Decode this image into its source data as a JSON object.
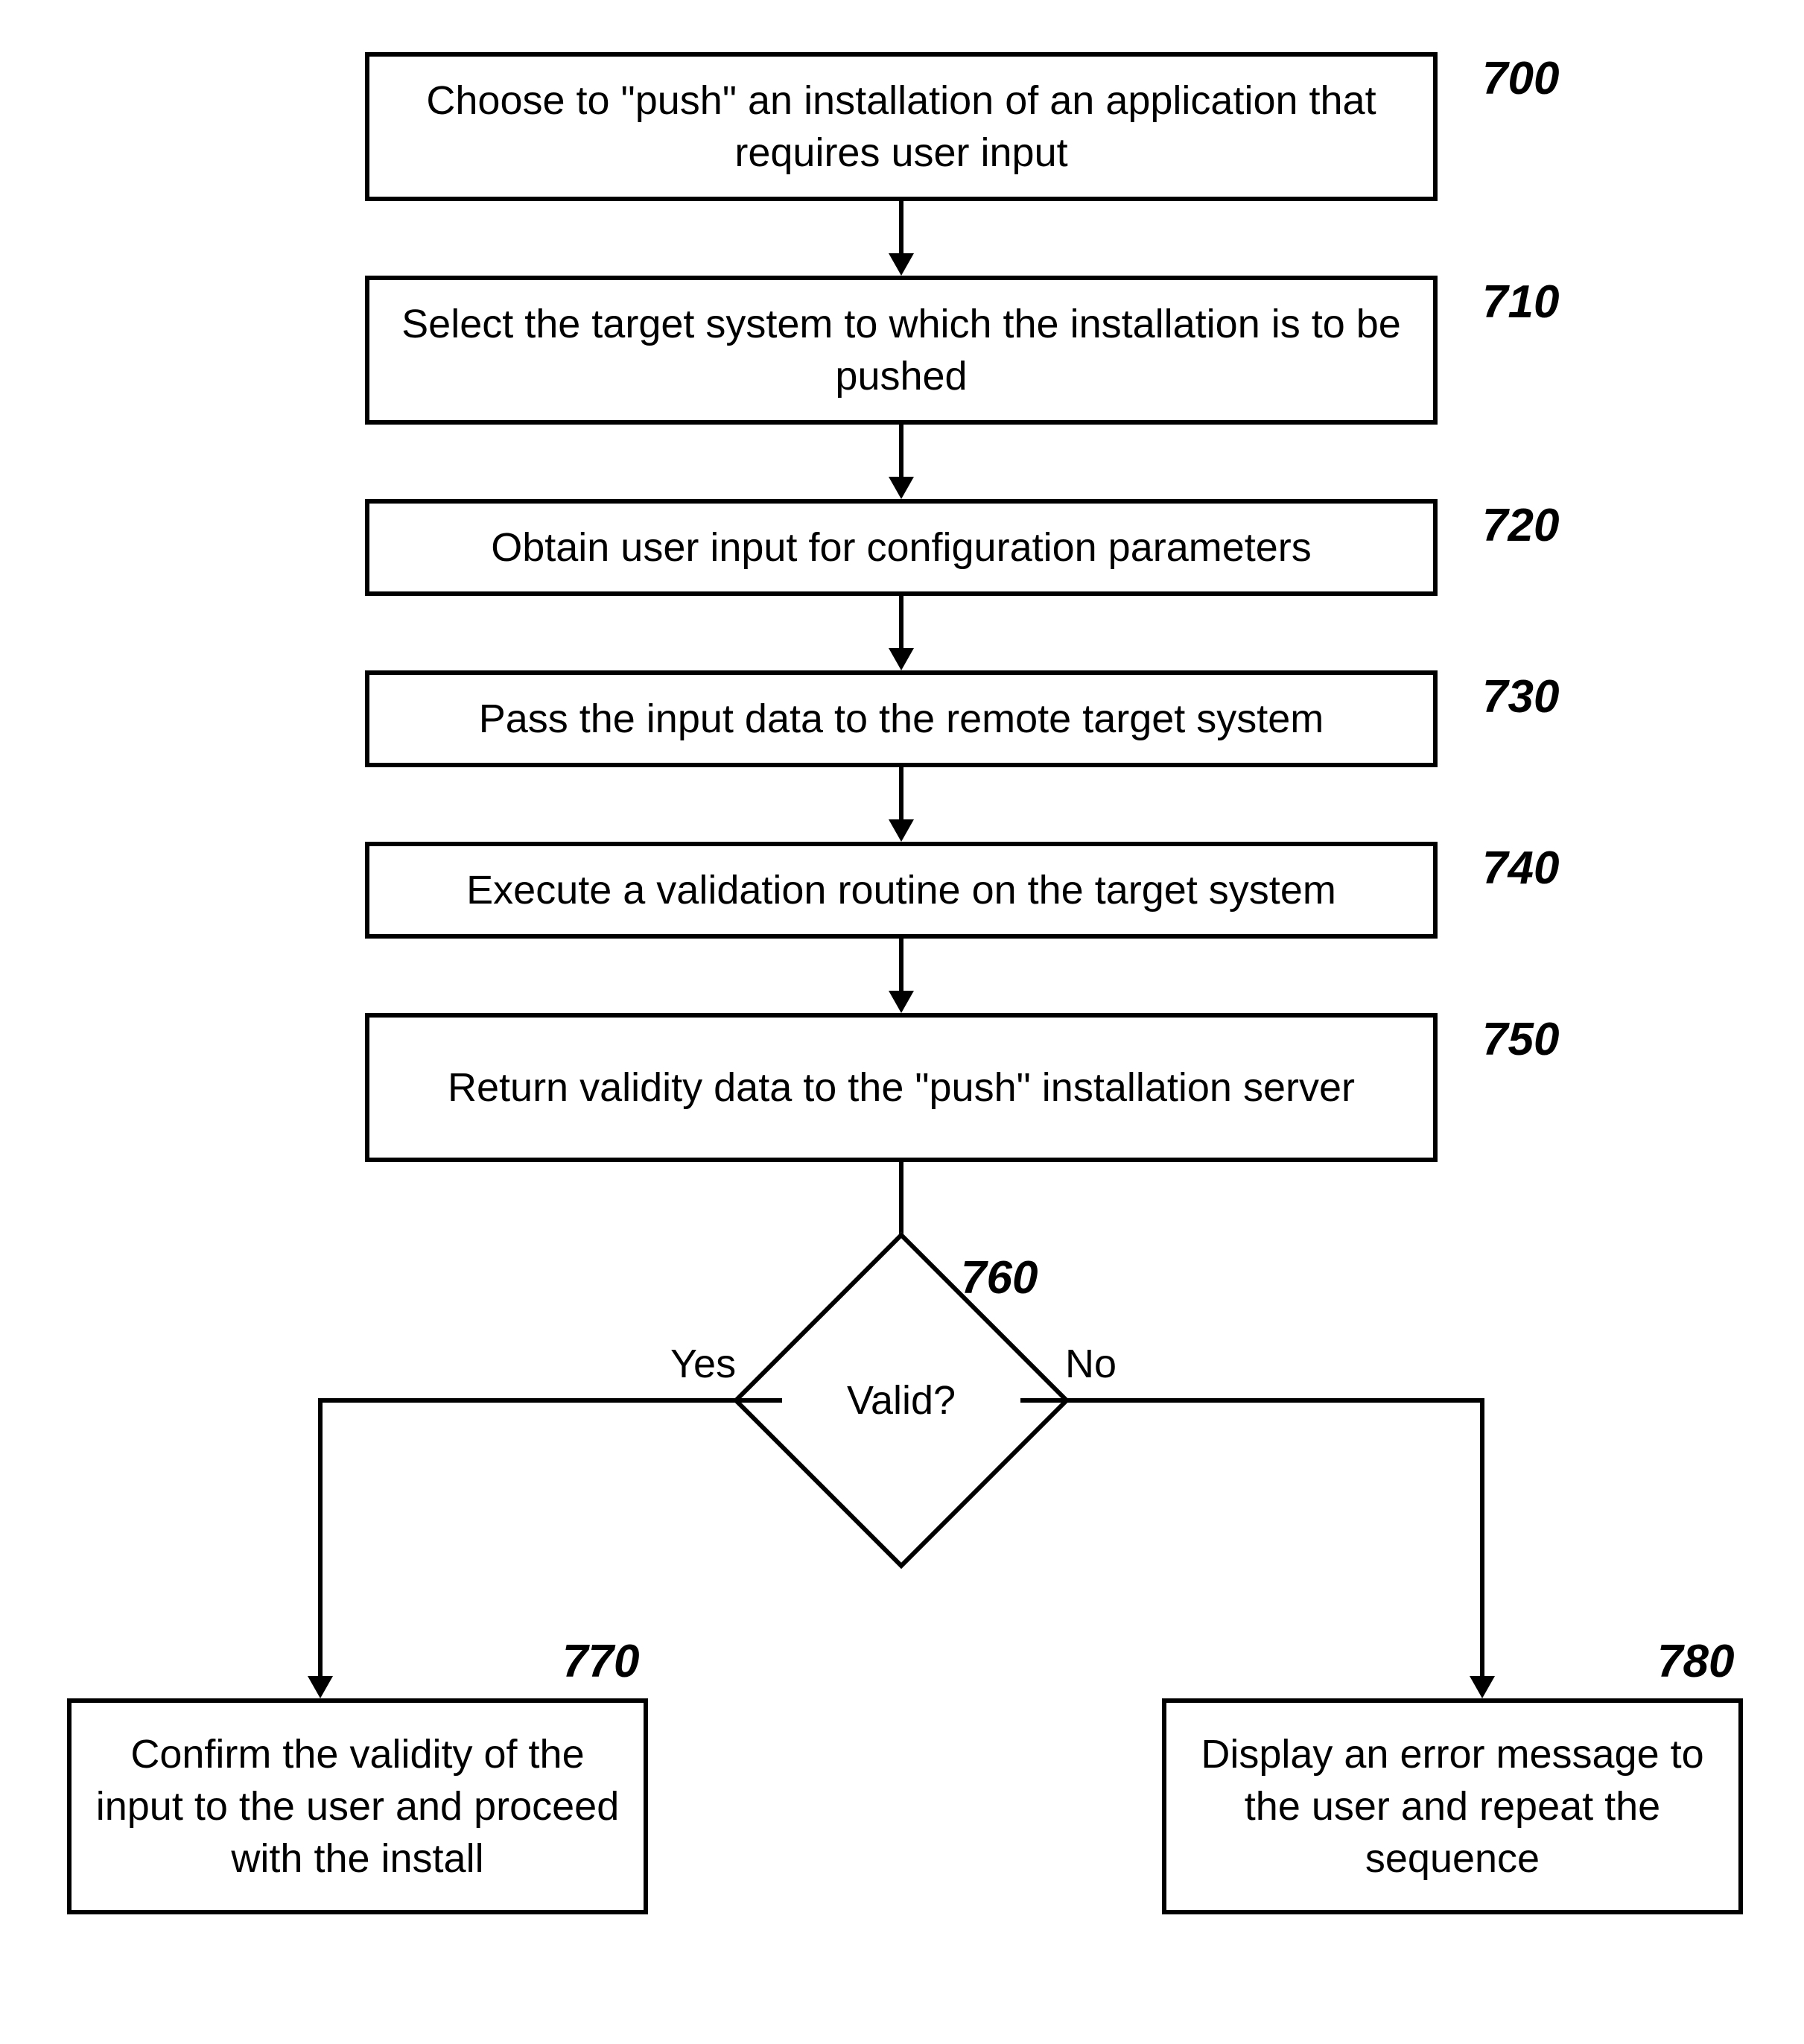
{
  "steps": {
    "s700": {
      "ref": "700",
      "text": "Choose to \"push\" an installation of an application that requires user input"
    },
    "s710": {
      "ref": "710",
      "text": "Select the target system to which the installation is to be pushed"
    },
    "s720": {
      "ref": "720",
      "text": "Obtain user input for configuration parameters"
    },
    "s730": {
      "ref": "730",
      "text": "Pass the input data to the remote target system"
    },
    "s740": {
      "ref": "740",
      "text": "Execute a validation routine on the target system"
    },
    "s750": {
      "ref": "750",
      "text": "Return validity data to the \"push\" installation server"
    },
    "s760": {
      "ref": "760",
      "text": "Valid?"
    },
    "s770": {
      "ref": "770",
      "text": "Confirm the validity of the input to the user and proceed with the install"
    },
    "s780": {
      "ref": "780",
      "text": "Display an error message to the user and repeat the sequence"
    }
  },
  "branch": {
    "yes": "Yes",
    "no": "No"
  }
}
